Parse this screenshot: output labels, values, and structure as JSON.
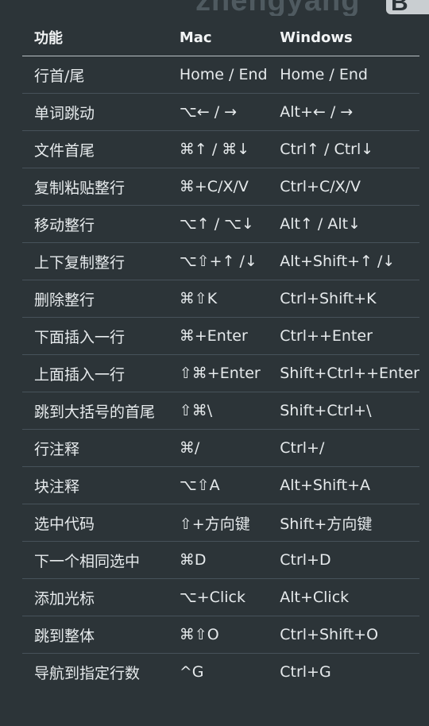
{
  "watermark": {
    "text": "zhengyang",
    "badge": "B"
  },
  "table": {
    "headers": {
      "function": "功能",
      "mac": "Mac",
      "windows": "Windows"
    },
    "rows": [
      {
        "function": "行首/尾",
        "mac": "Home / End",
        "windows": "Home / End"
      },
      {
        "function": "单词跳动",
        "mac": "⌥← / →",
        "windows": "Alt+← / →"
      },
      {
        "function": "文件首尾",
        "mac": "⌘↑ / ⌘↓",
        "windows": "Ctrl↑ / Ctrl↓"
      },
      {
        "function": "复制粘贴整行",
        "mac": "⌘+C/X/V",
        "windows": "Ctrl+C/X/V"
      },
      {
        "function": "移动整行",
        "mac": "⌥↑ / ⌥↓",
        "windows": "Alt↑ / Alt↓"
      },
      {
        "function": "上下复制整行",
        "mac": "⌥⇧+↑ /↓",
        "windows": "Alt+Shift+↑ /↓"
      },
      {
        "function": "删除整行",
        "mac": "⌘⇧K",
        "windows": "Ctrl+Shift+K"
      },
      {
        "function": "下面插入一行",
        "mac": "⌘+Enter",
        "windows": "Ctrl++Enter"
      },
      {
        "function": "上面插入一行",
        "mac": "⇧⌘+Enter",
        "windows": "Shift+Ctrl++Enter"
      },
      {
        "function": "跳到大括号的首尾",
        "mac": "⇧⌘\\",
        "windows": "Shift+Ctrl+\\"
      },
      {
        "function": "行注释",
        "mac": "⌘/",
        "windows": "Ctrl+/"
      },
      {
        "function": "块注释",
        "mac": "⌥⇧A",
        "windows": "Alt+Shift+A"
      },
      {
        "function": "选中代码",
        "mac": "⇧+方向键",
        "windows": "Shift+方向键"
      },
      {
        "function": "下一个相同选中",
        "mac": "⌘D",
        "windows": "Ctrl+D"
      },
      {
        "function": "添加光标",
        "mac": "⌥+Click",
        "windows": "Alt+Click"
      },
      {
        "function": "跳到整体",
        "mac": "⌘⇧O",
        "windows": "Ctrl+Shift+O"
      },
      {
        "function": "导航到指定行数",
        "mac": "^G",
        "windows": "Ctrl+G"
      }
    ]
  }
}
